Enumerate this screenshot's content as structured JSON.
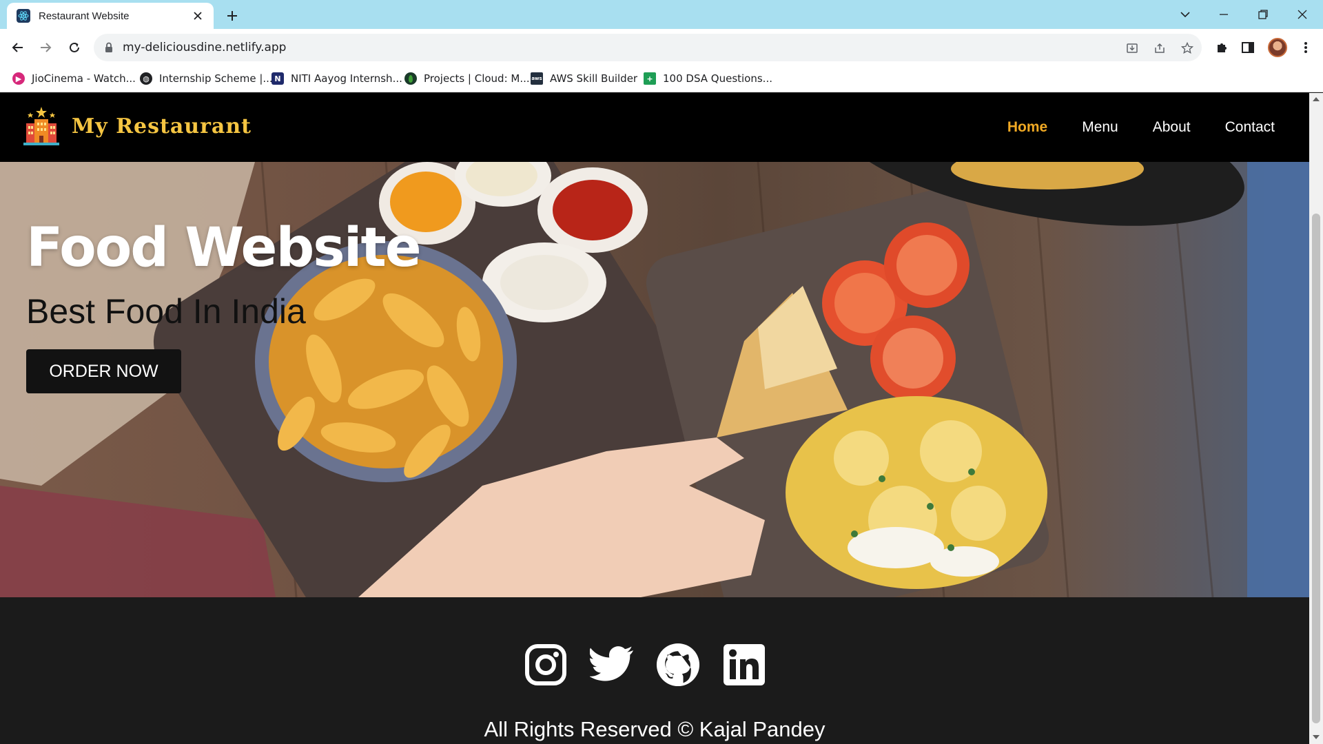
{
  "browser": {
    "tab_title": "Restaurant Website",
    "url": "my-deliciousdine.netlify.app",
    "bookmarks": [
      {
        "label": "JioCinema - Watch...",
        "icon": "jiocinema-icon",
        "color": "#d6287a"
      },
      {
        "label": "Internship Scheme |...",
        "icon": "globe-icon",
        "color": "#202124"
      },
      {
        "label": "NITI Aayog Internsh...",
        "icon": "notion-icon",
        "color": "#1f2a6b"
      },
      {
        "label": "Projects | Cloud: M...",
        "icon": "mongodb-icon",
        "color": "#1a3a2a"
      },
      {
        "label": "AWS Skill Builder",
        "icon": "aws-icon",
        "color": "#232f3e"
      },
      {
        "label": "100 DSA Questions...",
        "icon": "sheets-icon",
        "color": "#1e9e55"
      }
    ]
  },
  "nav": {
    "brand": "My Restaurant",
    "links": [
      "Home",
      "Menu",
      "About",
      "Contact"
    ],
    "active": "Home"
  },
  "hero": {
    "title": "Food Website",
    "subtitle": "Best Food In India",
    "button": "ORDER NOW"
  },
  "footer": {
    "social_icons": [
      "instagram-icon",
      "twitter-icon",
      "github-icon",
      "linkedin-icon"
    ],
    "copyright": "All Rights Reserved © Kajal Pandey"
  },
  "colors": {
    "tabbar": "#a8dff0",
    "nav_bg": "#000000",
    "brand": "#f5c542",
    "active_link": "#f0a924",
    "footer_bg": "#1b1b1b"
  }
}
